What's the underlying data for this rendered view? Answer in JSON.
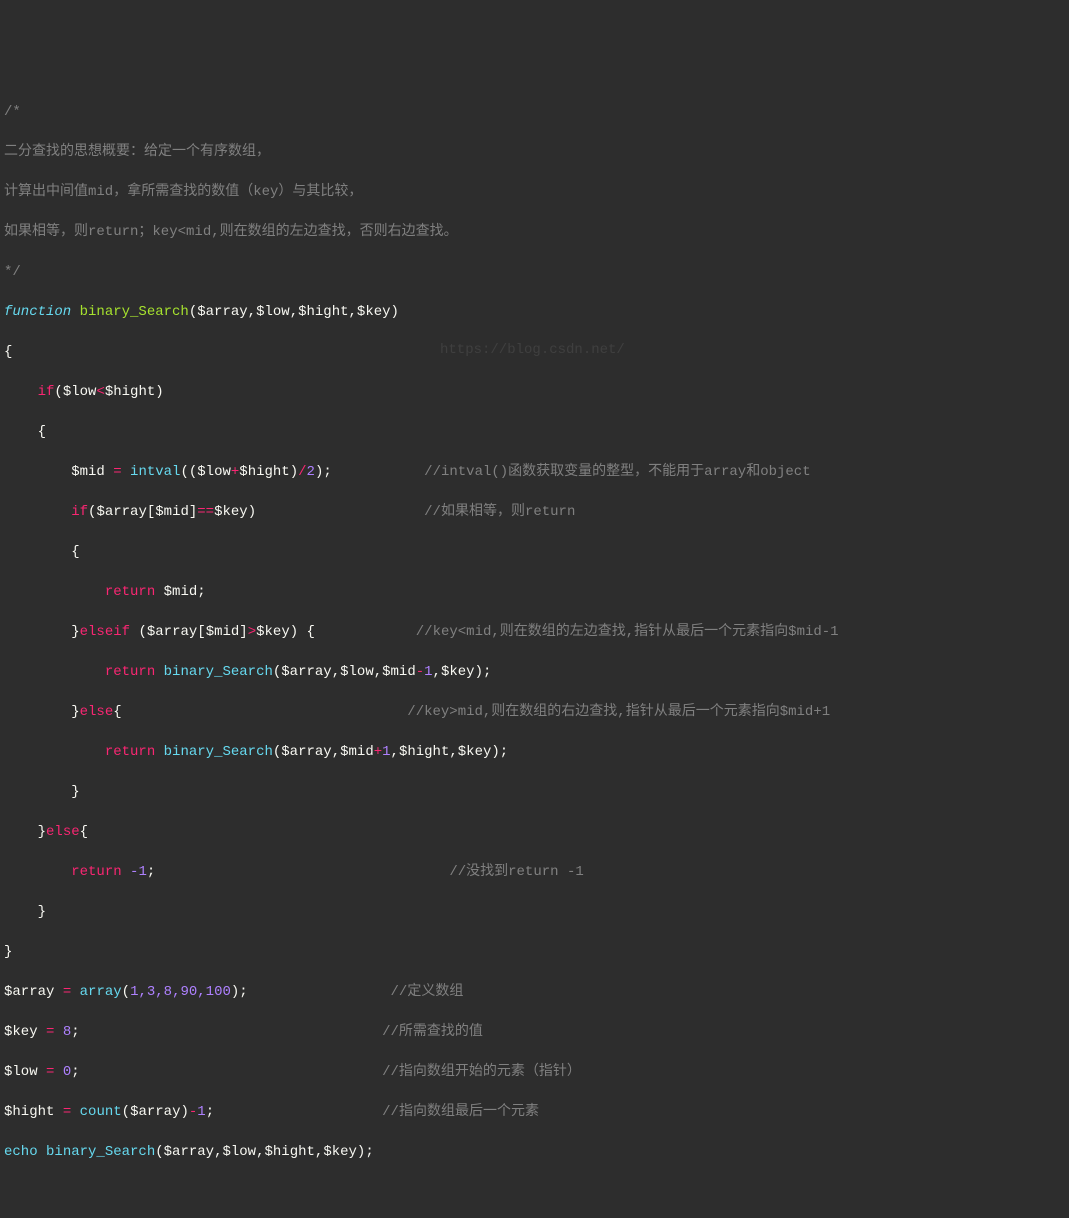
{
  "lines": {
    "c1": "/*",
    "c2": "二分查找的思想概要：给定一个有序数组，",
    "c3": "计算出中间值mid，拿所需查找的数值（key）与其比较，",
    "c4": "如果相等，则return；key<mid,则在数组的左边查找，否则右边查找。",
    "c5": "*/",
    "fn_kw": "function",
    "fn_name": " binary_Search",
    "fn_params_open": "(",
    "p_array": "$array",
    "p_low": "$low",
    "p_hight": "$hight",
    "p_key": "$key",
    "fn_params_close": ")",
    "brace_open": "{",
    "brace_close": "}",
    "if_kw": "if",
    "elseif_kw": "elseif",
    "else_kw": "else",
    "return_kw": "return",
    "lt": "<",
    "gt": ">",
    "eq": "=",
    "eqeq": "==",
    "plus": "+",
    "minus": "-",
    "div": "/",
    "comma": ",",
    "semi": ";",
    "lbrack": "[",
    "rbrack": "]",
    "lparen": "(",
    "rparen": ")",
    "mid": "$mid",
    "intval": "intval",
    "two": "2",
    "one": "1",
    "neg1": "-1",
    "cmt_intval": "//intval()函数获取变量的整型，不能用于array和object",
    "cmt_ifeq": "//如果相等，则return",
    "cmt_left": "//key<mid,则在数组的左边查找,指针从最后一个元素指向$mid-1",
    "cmt_right": "//key>mid,则在数组的右边查找,指针从最后一个元素指向$mid+1",
    "cmt_notfound": "//没找到return -1",
    "cmt_defarr": "//定义数组",
    "cmt_keyval": "//所需查找的值",
    "cmt_lowval": "//指向数组开始的元素（指针）",
    "cmt_hightval": "//指向数组最后一个元素",
    "array_kw": "array",
    "arr_vals": "1,3,8,90,100",
    "eight": "8",
    "zero": "0",
    "count": "count",
    "echo": "echo",
    "binary_search_call": "binary_Search",
    "watermark": "https://blog.csdn.net/"
  }
}
